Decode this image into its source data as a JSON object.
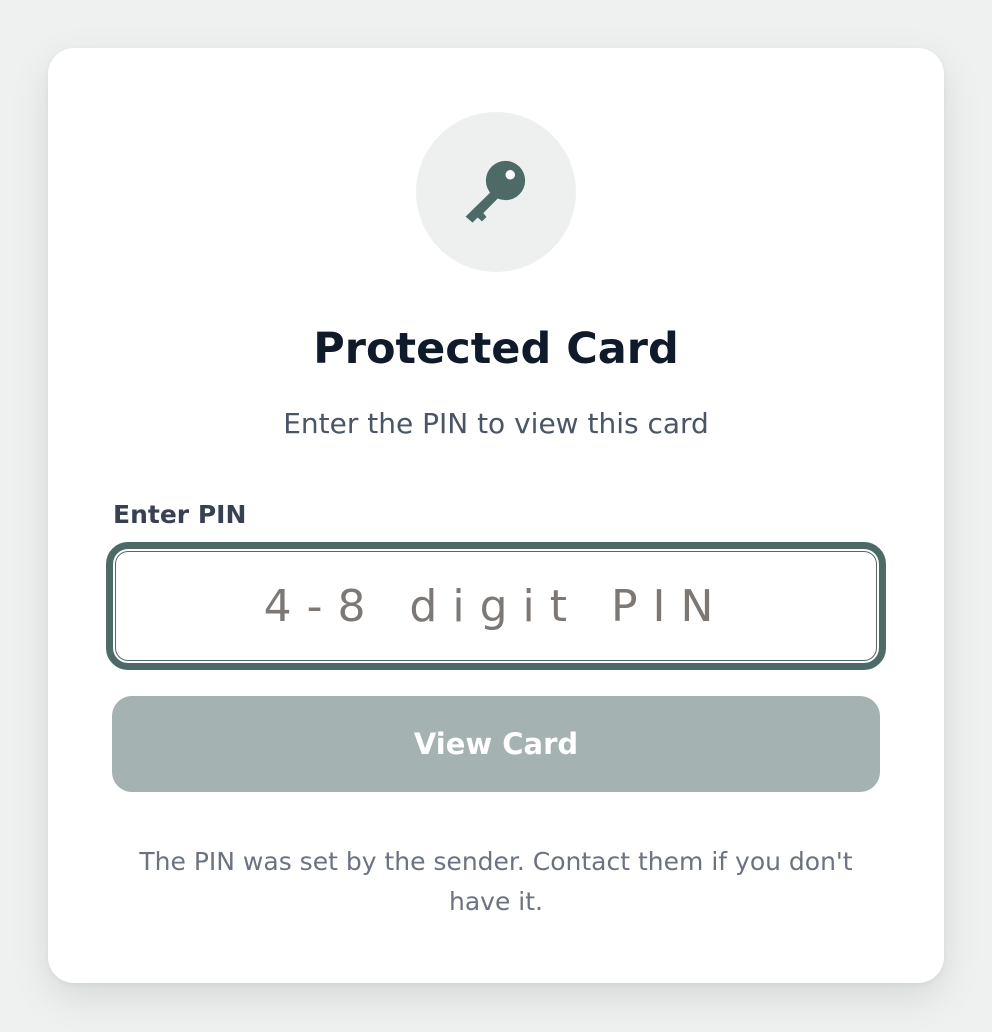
{
  "card": {
    "icon": "key-icon",
    "title": "Protected Card",
    "subtitle": "Enter the PIN to view this card"
  },
  "pin": {
    "label": "Enter PIN",
    "placeholder": "4-8 digit PIN",
    "value": ""
  },
  "actions": {
    "view_label": "View Card"
  },
  "footnote": "The PIN was set by the sender. Contact them if you don't have it.",
  "colors": {
    "accent": "#4d6a66",
    "button_disabled": "#a4b3b1",
    "icon_bg": "#edf0ef",
    "page_bg": "#eef1f0"
  }
}
